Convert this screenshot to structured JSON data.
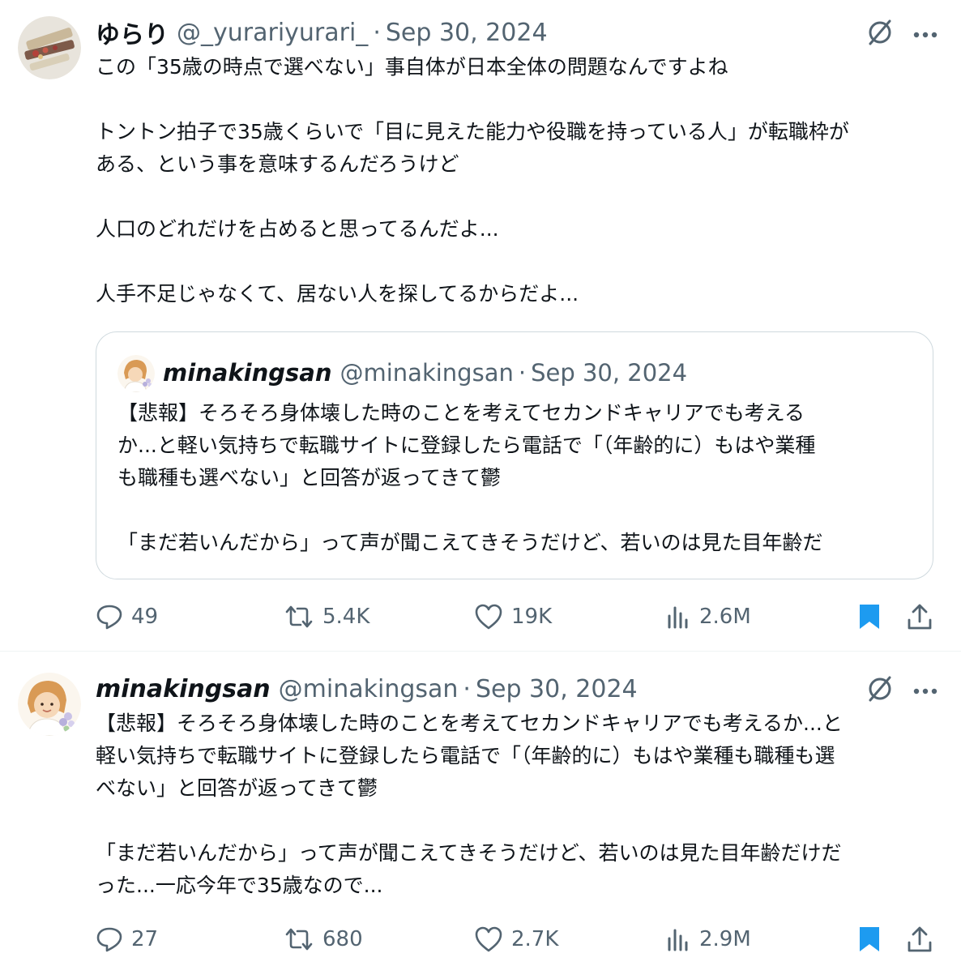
{
  "tweet1": {
    "author_name": "ゆらり",
    "handle": "@_yurariyurari_",
    "date": "Sep 30, 2024",
    "lines": [
      "この「35歳の時点で選べない」事自体が日本全体の問題なんですよね",
      "",
      "トントン拍子で35歳くらいで「目に見えた能力や役職を持っている人」が転職枠が",
      "ある、という事を意味するんだろうけど",
      "",
      "人口のどれだけを占めると思ってるんだよ...",
      "",
      "人手不足じゃなくて、居ない人を探してるからだよ..."
    ],
    "quote": {
      "author_name": "minakingsan",
      "handle": "@minakingsan",
      "date": "Sep 30, 2024",
      "lines": [
        "【悲報】そろそろ身体壊した時のことを考えてセカンドキャリアでも考える",
        "か...と軽い気持ちで転職サイトに登録したら電話で「（年齢的に）もはや業種",
        "も職種も選べない」と回答が返ってきて鬱",
        "",
        "「まだ若いんだから」って声が聞こえてきそうだけど、若いのは見た目年齢だ"
      ]
    },
    "stats": {
      "replies": "49",
      "reposts": "5.4K",
      "likes": "19K",
      "views": "2.6M"
    }
  },
  "tweet2": {
    "author_name": "minakingsan",
    "handle": "@minakingsan",
    "date": "Sep 30, 2024",
    "lines": [
      "【悲報】そろそろ身体壊した時のことを考えてセカンドキャリアでも考えるか...と",
      "軽い気持ちで転職サイトに登録したら電話で「（年齢的に）もはや業種も職種も選",
      "べない」と回答が返ってきて鬱",
      "",
      "「まだ若いんだから」って声が聞こえてきそうだけど、若いのは見た目年齢だけだ",
      "った...一応今年で35歳なので..."
    ],
    "stats": {
      "replies": "27",
      "reposts": "680",
      "likes": "2.7K",
      "views": "2.9M"
    }
  },
  "separator": "·",
  "colors": {
    "text": "#0f1419",
    "secondary": "#536471",
    "accent": "#1d9bf0",
    "border": "#cfd9de"
  },
  "icons": [
    "grok-icon",
    "more-icon",
    "reply-icon",
    "repost-icon",
    "like-icon",
    "views-icon",
    "bookmark-icon",
    "share-icon"
  ]
}
